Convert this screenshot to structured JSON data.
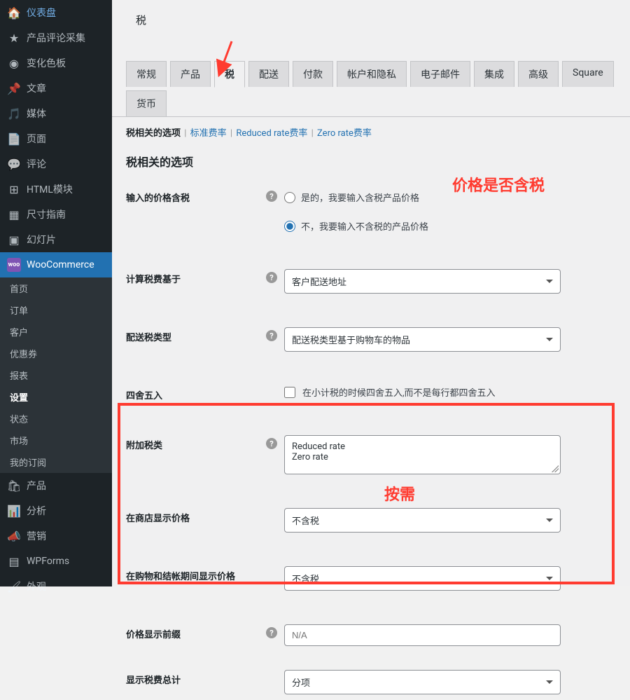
{
  "sidebar": {
    "items": [
      {
        "label": "仪表盘",
        "icon": "dashboard"
      },
      {
        "label": "产品评论采集",
        "icon": "star"
      },
      {
        "label": "变化色板",
        "icon": "swatch"
      },
      {
        "label": "文章",
        "icon": "pin"
      },
      {
        "label": "媒体",
        "icon": "media"
      },
      {
        "label": "页面",
        "icon": "page"
      },
      {
        "label": "评论",
        "icon": "comment"
      },
      {
        "label": "HTML模块",
        "icon": "html"
      },
      {
        "label": "尺寸指南",
        "icon": "grid"
      },
      {
        "label": "幻灯片",
        "icon": "slides"
      },
      {
        "label": "WooCommerce",
        "icon": "woo"
      },
      {
        "label": "产品",
        "icon": "product"
      },
      {
        "label": "分析",
        "icon": "chart"
      },
      {
        "label": "营销",
        "icon": "mega"
      },
      {
        "label": "WPForms",
        "icon": "forms"
      },
      {
        "label": "外观",
        "icon": "brush"
      }
    ],
    "submenu": [
      {
        "label": "首页"
      },
      {
        "label": "订单"
      },
      {
        "label": "客户"
      },
      {
        "label": "优惠券"
      },
      {
        "label": "报表"
      },
      {
        "label": "设置"
      },
      {
        "label": "状态"
      },
      {
        "label": "市场"
      },
      {
        "label": "我的订阅"
      }
    ]
  },
  "page_title": "税",
  "tabs": [
    {
      "label": "常规"
    },
    {
      "label": "产品"
    },
    {
      "label": "税"
    },
    {
      "label": "配送"
    },
    {
      "label": "付款"
    },
    {
      "label": "帐户和隐私"
    },
    {
      "label": "电子邮件"
    },
    {
      "label": "集成"
    },
    {
      "label": "高级"
    },
    {
      "label": "Square"
    },
    {
      "label": "货币"
    }
  ],
  "subtabs": {
    "current": "税相关的选项",
    "links": [
      "标准费率",
      "Reduced rate费率",
      "Zero rate费率"
    ]
  },
  "section_title": "税相关的选项",
  "f": {
    "prices_include_tax": {
      "label": "输入的价格含税",
      "opt_yes": "是的，我要输入含税产品价格",
      "opt_no": "不，我要输入不含税的产品价格"
    },
    "calc_based": {
      "label": "计算税费基于",
      "value": "客户配送地址"
    },
    "shipping_tax": {
      "label": "配送税类型",
      "value": "配送税类型基于购物车的物品"
    },
    "rounding": {
      "label": "四舍五入",
      "desc": "在小计税的时候四舍五入,而不是每行都四舍五入"
    },
    "additional": {
      "label": "附加税类",
      "value": "Reduced rate\nZero rate"
    },
    "shop_display": {
      "label": "在商店显示价格",
      "value": "不含税"
    },
    "cart_display": {
      "label": "在购物和结帐期间显示价格",
      "value": "不含税"
    },
    "price_suffix": {
      "label": "价格显示前缀",
      "placeholder": "N/A"
    },
    "tax_totals": {
      "label": "显示税费总计",
      "value": "分项"
    }
  },
  "annotations": {
    "a1": "价格是否含税",
    "a2": "按需"
  }
}
